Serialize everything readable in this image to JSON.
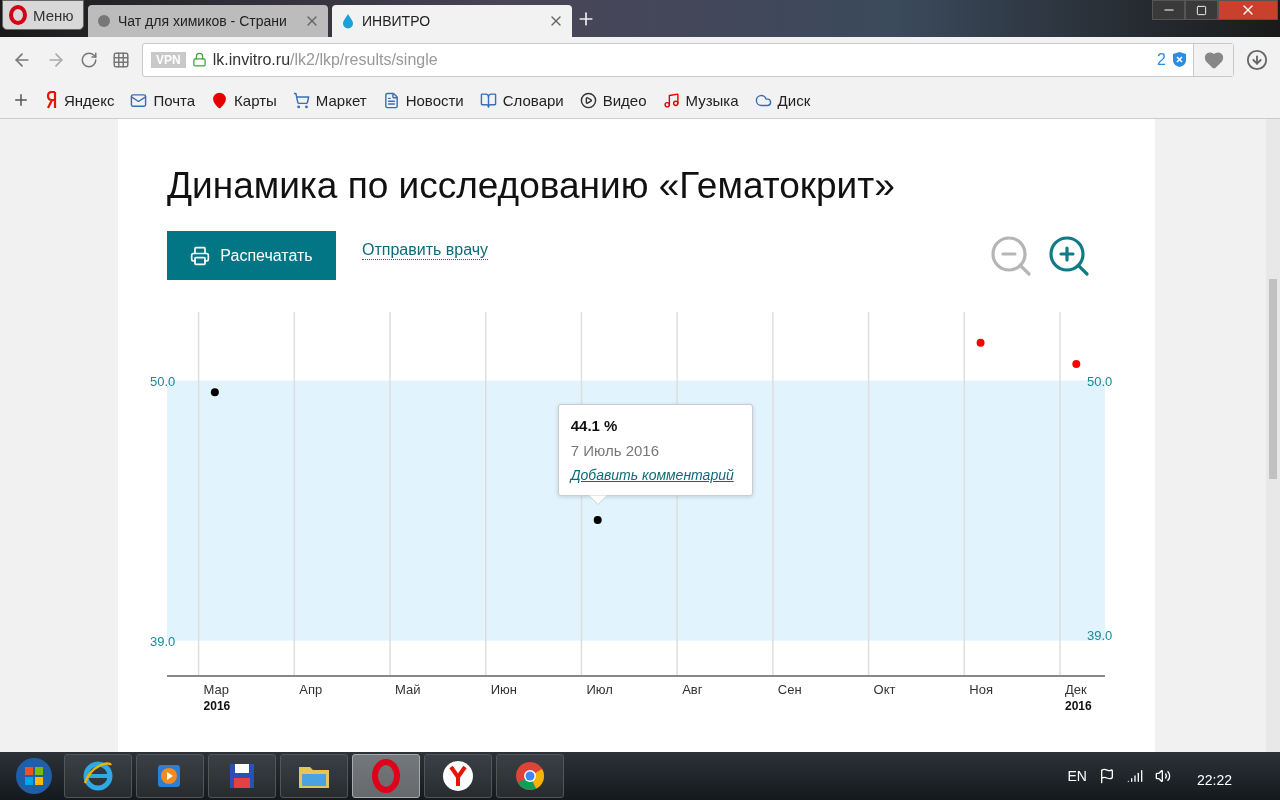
{
  "browser": {
    "menu_button": "Меню",
    "tabs": [
      {
        "title": "Чат для химиков - Страни",
        "selected": false
      },
      {
        "title": "ИНВИТРО",
        "selected": true
      }
    ],
    "address": {
      "vpn": "VPN",
      "host": "lk.invitro.ru",
      "path": "/lk2/lkp/results/single",
      "blocked_count": "2"
    },
    "bookmarks": [
      {
        "label": "Яндекс",
        "kind": "yandex"
      },
      {
        "label": "Почта",
        "kind": "mail"
      },
      {
        "label": "Карты",
        "kind": "maps"
      },
      {
        "label": "Маркет",
        "kind": "market"
      },
      {
        "label": "Новости",
        "kind": "news"
      },
      {
        "label": "Словари",
        "kind": "dictionary"
      },
      {
        "label": "Видео",
        "kind": "video"
      },
      {
        "label": "Музыка",
        "kind": "music"
      },
      {
        "label": "Диск",
        "kind": "disk"
      }
    ]
  },
  "page": {
    "title": "Динамика по исследованию «Гематокрит»",
    "print_button": "Распечатать",
    "send_link": "Отправить врачу",
    "zoom_out": {
      "disabled": true
    },
    "zoom_in": {
      "disabled": false
    },
    "chart_data": {
      "type": "scatter",
      "ylim": [
        37.5,
        52.9
      ],
      "categories": [
        "Мар\n2016",
        "Апр",
        "Май",
        "Июн",
        "Июл",
        "Авг",
        "Сен",
        "Окт",
        "Ноя",
        "Дек\n2016"
      ],
      "yticks": [
        {
          "value": 39,
          "label": "39.0"
        },
        {
          "value": 50,
          "label": "50.0"
        }
      ],
      "bands": [
        {
          "axis": "y",
          "from": 39,
          "to": 50
        }
      ],
      "series": [
        {
          "color": "#000000",
          "values": [
            49.5,
            null,
            null,
            null,
            44.1,
            null,
            null,
            null,
            null,
            null
          ]
        },
        {
          "color": "#ff0000",
          "values": [
            null,
            null,
            null,
            null,
            null,
            null,
            null,
            null,
            51.6,
            50.7
          ]
        }
      ]
    },
    "tooltip": {
      "value": "44.1 %",
      "date": "7 Июль 2016",
      "link": "Добавить комментарий"
    }
  },
  "taskbar": {
    "apps": [
      {
        "kind": "ie",
        "selected": false
      },
      {
        "kind": "player",
        "selected": false
      },
      {
        "kind": "floppy",
        "selected": false
      },
      {
        "kind": "folder",
        "selected": false
      },
      {
        "kind": "opera",
        "selected": true
      },
      {
        "kind": "yandex",
        "selected": false
      },
      {
        "kind": "chrome",
        "selected": false
      }
    ],
    "language": "EN",
    "time": "22:22"
  }
}
